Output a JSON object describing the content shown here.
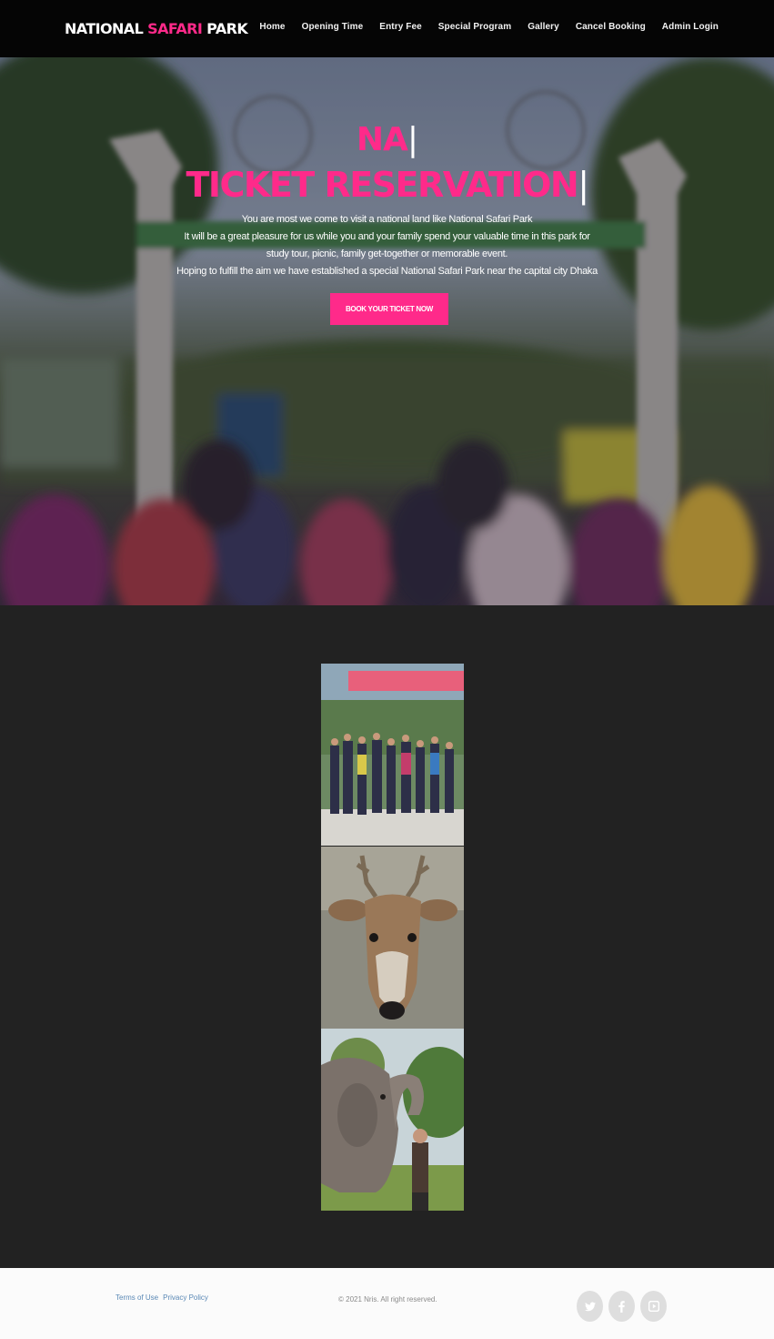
{
  "brand": {
    "part1": "NATIONAL ",
    "part2": "SAFARI",
    "part3": " PARK"
  },
  "nav": [
    "Home",
    "Opening Time",
    "Entry Fee",
    "Special Program",
    "Gallery",
    "Cancel Booking",
    "Admin Login"
  ],
  "hero": {
    "line1": "NA",
    "line2": "TICKET RESERVATION",
    "caret": "|",
    "paragraph": [
      "You are most we come to visit a national land like National Safari Park",
      "It will be a great pleasure for us while you and your family spend your valuable time in this park for",
      "study tour, picnic, family get-together or memorable event.",
      "Hoping to fulfill the aim we have established a special National Safari Park near the capital city Dhaka"
    ],
    "button": "BOOK YOUR TICKET NOW"
  },
  "footer": {
    "terms": "Terms of Use",
    "privacy": "Privacy Policy",
    "copyright": "© 2021 Nris. All right reserved.",
    "social_icons": [
      "twitter-icon",
      "facebook-icon",
      "youtube-icon"
    ]
  },
  "colors": {
    "accent": "#ff2a8a",
    "navbar": "#050505",
    "page": "#222222",
    "footer": "#fbfbfb"
  }
}
